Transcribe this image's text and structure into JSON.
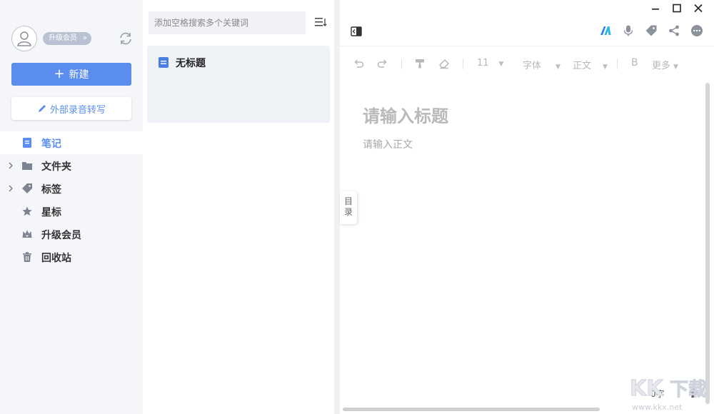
{
  "sidebar": {
    "vip_badge": "升级会员",
    "new_button": "新建",
    "external_button": "外部录音转写",
    "nav": [
      {
        "label": "笔记",
        "icon": "note-icon",
        "active": true
      },
      {
        "label": "文件夹",
        "icon": "folder-icon",
        "expandable": true
      },
      {
        "label": "标签",
        "icon": "tag-icon",
        "expandable": true
      },
      {
        "label": "星标",
        "icon": "star-icon"
      },
      {
        "label": "升级会员",
        "icon": "crown-icon"
      },
      {
        "label": "回收站",
        "icon": "trash-icon"
      }
    ]
  },
  "list": {
    "search_placeholder": "添加空格搜索多个关键词",
    "notes": [
      {
        "title": "无标题",
        "icon": "doc-icon"
      }
    ]
  },
  "editor": {
    "toolbar": {
      "font_size": "11",
      "font_family": "字体",
      "paragraph": "正文",
      "bold": "B",
      "more": "更多"
    },
    "title_placeholder": "请输入标题",
    "body_placeholder": "请输入正文",
    "toc_tab": "目录",
    "word_count": "0字"
  },
  "watermark": {
    "text": "www.kkx.net"
  },
  "colors": {
    "accent": "#5b8def",
    "sidebar_bg": "#f5f6f9",
    "card_bg": "#eef1f6"
  }
}
